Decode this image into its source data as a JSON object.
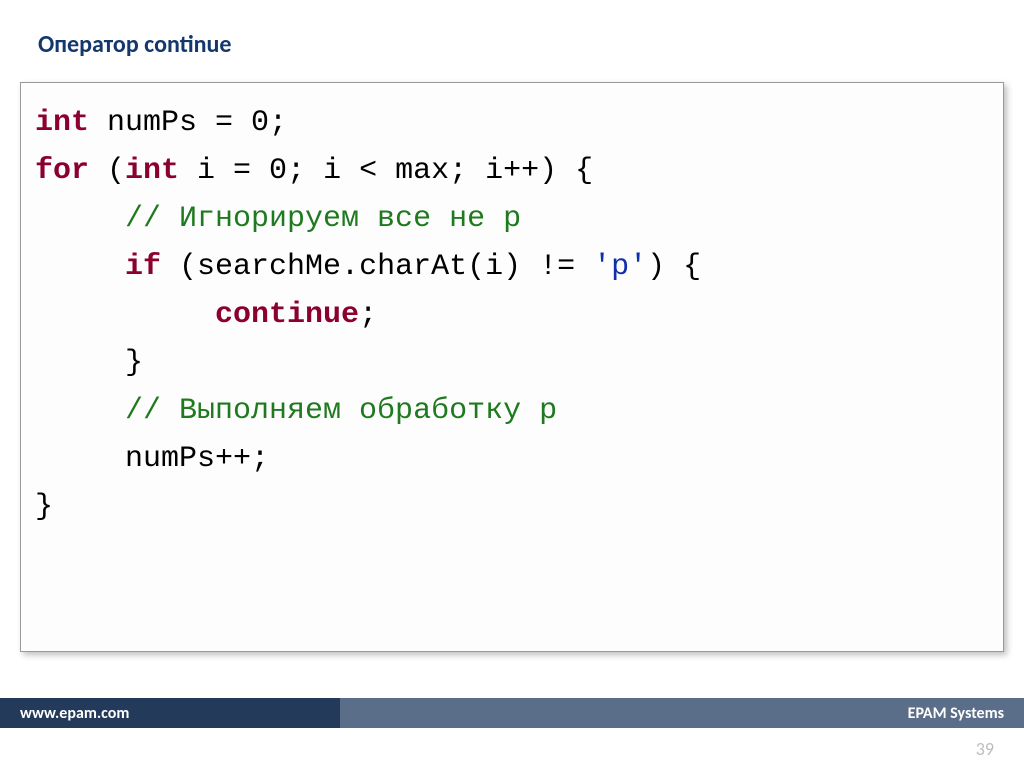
{
  "title": "Оператор continue",
  "code": {
    "l1_kw1": "int",
    "l1_rest": " numPs = 0;",
    "l2_kw1": "for",
    "l2_p1": " (",
    "l2_kw2": "int",
    "l2_rest": " i = 0; i < max; i++) {",
    "l3_cm": "// Игнорируем все не p",
    "l4_kw": "if",
    "l4_p1": " (searchMe.charAt(i) != ",
    "l4_str": "'p'",
    "l4_p2": ") {",
    "l5_kw": "continue",
    "l5_rest": ";",
    "l6": "}",
    "l7_cm": "// Выполняем обработку p",
    "l8": "numPs++;",
    "l9": "}"
  },
  "indent": {
    "n0": "",
    "n1": "     ",
    "n2": "          "
  },
  "footer": {
    "url": "www.epam.com",
    "brand": "EPAM Systems"
  },
  "page_number": "39"
}
